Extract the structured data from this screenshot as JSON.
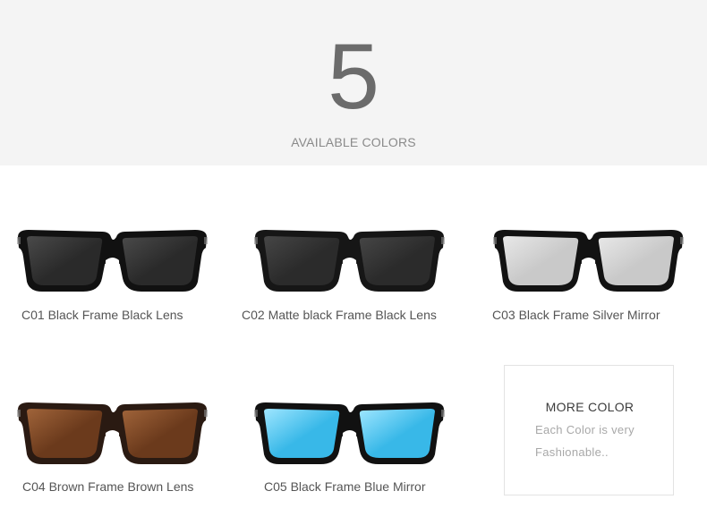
{
  "header": {
    "count": "5",
    "caption": "AVAILABLE COLORS"
  },
  "products": [
    {
      "code_label": "C01 Black Frame Black Lens",
      "frame_color": "#111111",
      "lens_color": "#2a2a2a",
      "lens_highlight": "#4a4a4a"
    },
    {
      "code_label": "C02  Matte black Frame Black Lens",
      "frame_color": "#161616",
      "lens_color": "#2b2b2b",
      "lens_highlight": "#464646"
    },
    {
      "code_label": "C03 Black Frame Silver Mirror",
      "frame_color": "#121212",
      "lens_color": "#c9c9c9",
      "lens_highlight": "#e8e8e8"
    },
    {
      "code_label": "C04 Brown Frame Brown Lens",
      "frame_color": "#2a1a12",
      "lens_color": "#6b3a1c",
      "lens_highlight": "#a0643a"
    },
    {
      "code_label": "C05 Black Frame Blue Mirror",
      "frame_color": "#111111",
      "lens_color": "#38b8e8",
      "lens_highlight": "#9fe6ff"
    }
  ],
  "more_color": {
    "title": "MORE COLOR",
    "line1": "Each Color is very",
    "line2": "Fashionable.."
  }
}
